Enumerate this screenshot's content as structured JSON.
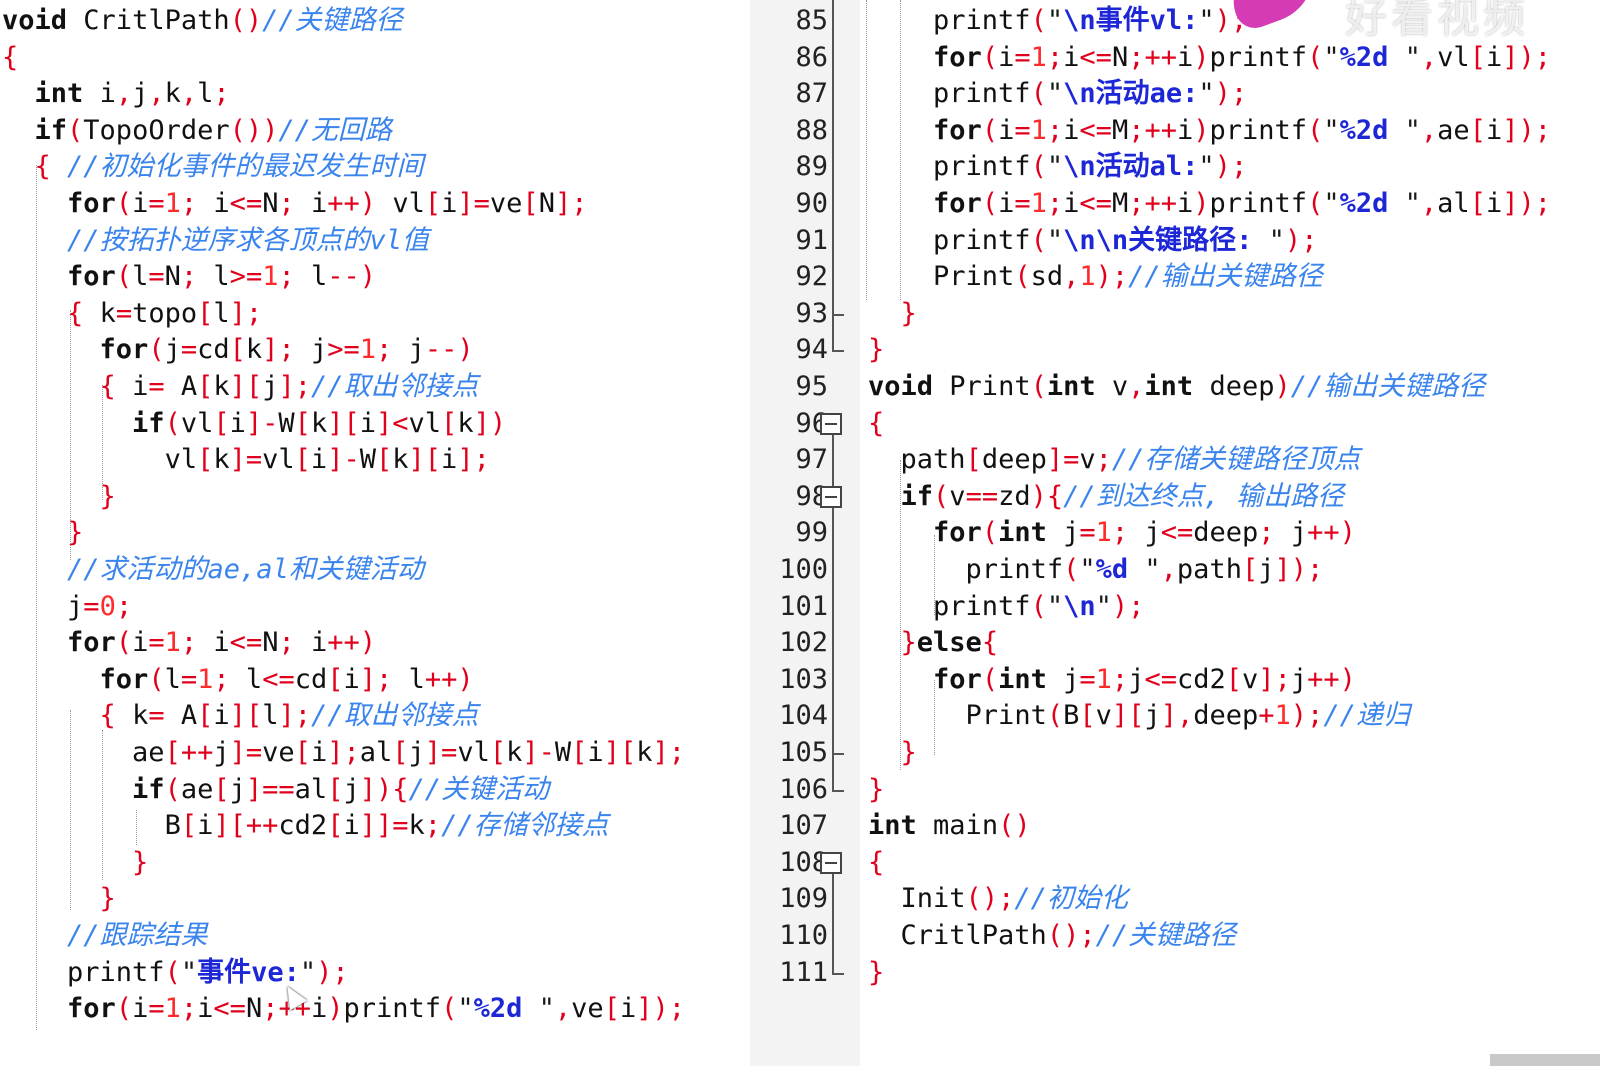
{
  "watermark": "好看视频",
  "left_lines": [
    "void CritlPath()//关键路径",
    "{",
    "  int i,j,k,l;",
    "  if(TopoOrder())//无回路",
    "  { //初始化事件的最迟发生时间",
    "    for(i=1; i<=N; i++) vl[i]=ve[N];",
    "    //按拓扑逆序求各顶点的vl值",
    "    for(l=N; l>=1; l--)",
    "    { k=topo[l];",
    "      for(j=cd[k]; j>=1; j--)",
    "      { i= A[k][j];//取出邻接点",
    "        if(vl[i]-W[k][i]<vl[k])",
    "          vl[k]=vl[i]-W[k][i];",
    "      }",
    "    }",
    "    //求活动的ae,al和关键活动",
    "    j=0;",
    "    for(i=1; i<=N; i++)",
    "      for(l=1; l<=cd[i]; l++)",
    "      { k= A[i][l];//取出邻接点",
    "        ae[++j]=ve[i];al[j]=vl[k]-W[i][k];",
    "        if(ae[j]==al[j]){//关键活动",
    "          B[i][++cd2[i]]=k;//存储邻接点",
    "        }",
    "      }",
    "    //跟踪结果",
    "    printf(\"事件ve:\");",
    "    for(i=1;i<=N;++i)printf(\"%2d \",ve[i]);"
  ],
  "right_lines": [
    {
      "num": "85",
      "text": "    printf(\"\\n事件vl:\");"
    },
    {
      "num": "86",
      "text": "    for(i=1;i<=N;++i)printf(\"%2d \",vl[i]);"
    },
    {
      "num": "87",
      "text": "    printf(\"\\n活动ae:\");"
    },
    {
      "num": "88",
      "text": "    for(i=1;i<=M;++i)printf(\"%2d \",ae[i]);"
    },
    {
      "num": "89",
      "text": "    printf(\"\\n活动al:\");"
    },
    {
      "num": "90",
      "text": "    for(i=1;i<=M;++i)printf(\"%2d \",al[i]);"
    },
    {
      "num": "91",
      "text": "    printf(\"\\n\\n关键路径: \");"
    },
    {
      "num": "92",
      "text": "    Print(sd,1);//输出关键路径"
    },
    {
      "num": "93",
      "text": "  }"
    },
    {
      "num": "94",
      "text": "}"
    },
    {
      "num": "95",
      "text": "void Print(int v,int deep)//输出关键路径"
    },
    {
      "num": "96",
      "text": "{"
    },
    {
      "num": "97",
      "text": "  path[deep]=v;//存储关键路径顶点"
    },
    {
      "num": "98",
      "text": "  if(v==zd){//到达终点, 输出路径"
    },
    {
      "num": "99",
      "text": "    for(int j=1; j<=deep; j++)"
    },
    {
      "num": "100",
      "text": "      printf(\"%d \",path[j]);"
    },
    {
      "num": "101",
      "text": "    printf(\"\\n\");"
    },
    {
      "num": "102",
      "text": "  }else{"
    },
    {
      "num": "103",
      "text": "    for(int j=1;j<=cd2[v];j++)"
    },
    {
      "num": "104",
      "text": "      Print(B[v][j],deep+1);//递归"
    },
    {
      "num": "105",
      "text": "  }"
    },
    {
      "num": "106",
      "text": "}"
    },
    {
      "num": "107",
      "text": "int main()"
    },
    {
      "num": "108",
      "text": "{"
    },
    {
      "num": "109",
      "text": "  Init();//初始化"
    },
    {
      "num": "110",
      "text": "  CritlPath();//关键路径"
    },
    {
      "num": "111",
      "text": "}"
    }
  ],
  "colors": {
    "keyword": "#111111",
    "punct": "#e0001c",
    "comment": "#3a84ee",
    "string_escape": "#1d27d6",
    "gutter_bg": "#f3f3f3"
  }
}
